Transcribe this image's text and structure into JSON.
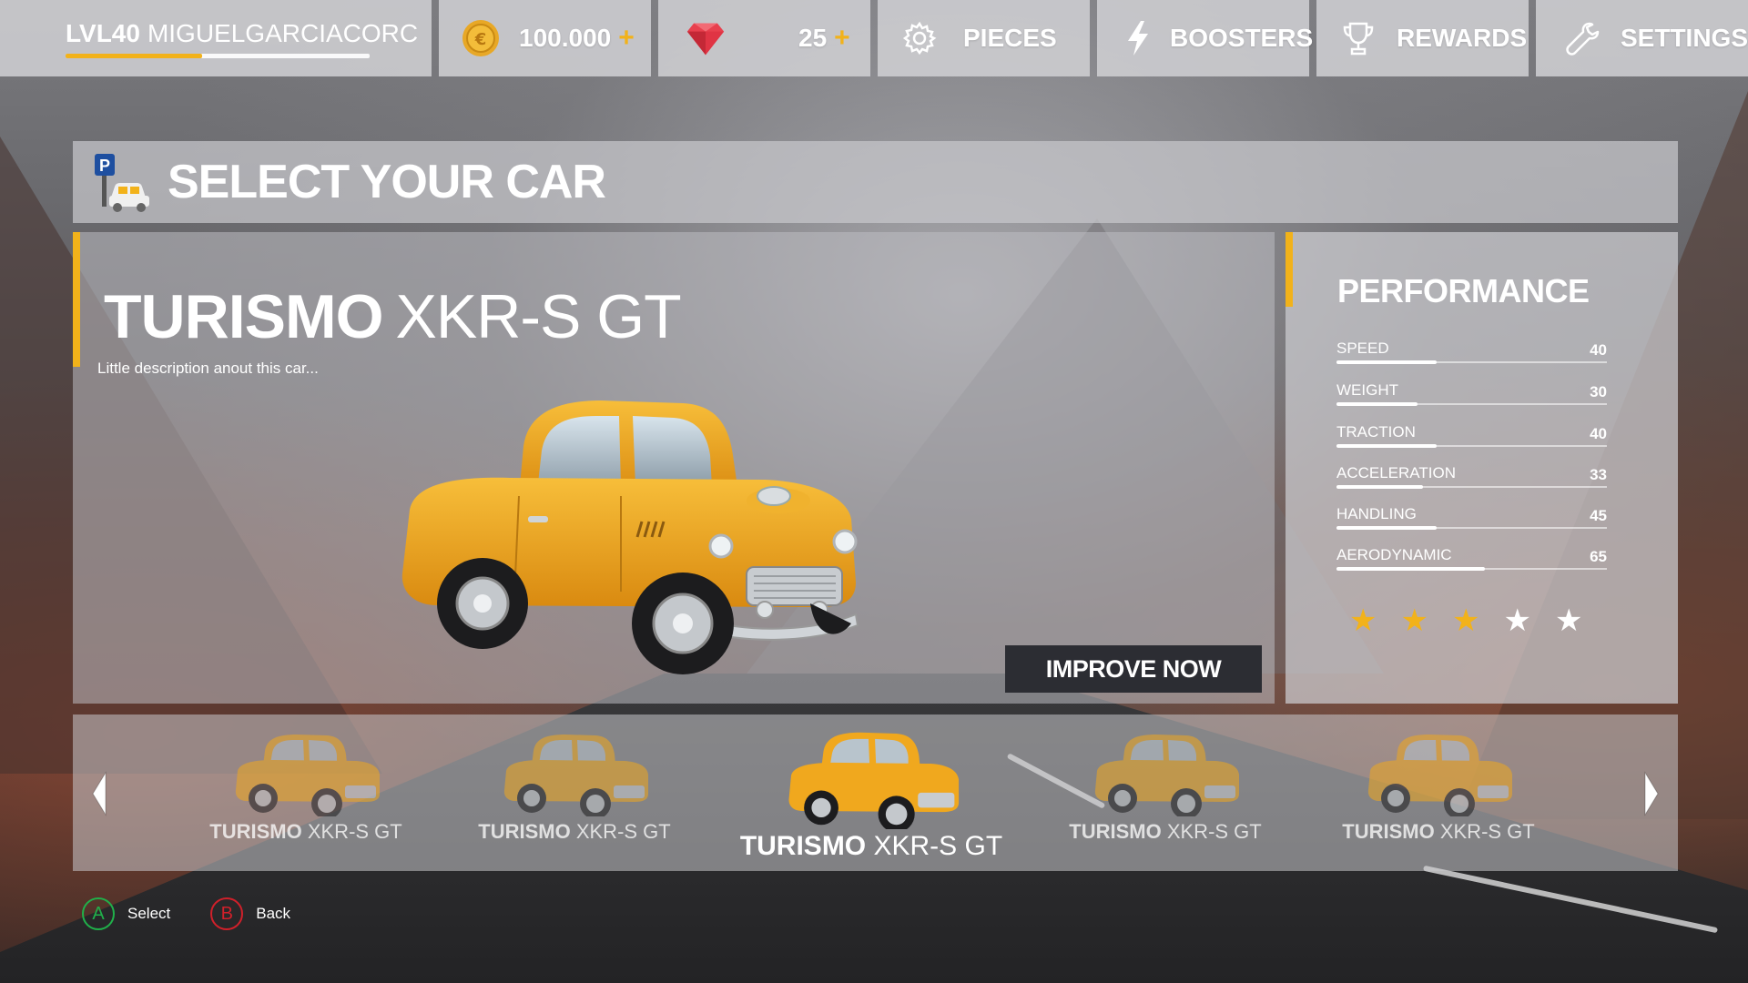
{
  "topbar": {
    "player": {
      "level": "LVL40",
      "name": "MIGUELGARCIACORC",
      "xp_progress": 0.45
    },
    "coins": {
      "value": "100.000",
      "icon": "euro-coin-icon",
      "plus": "+"
    },
    "gems": {
      "value": "25",
      "icon": "ruby-gem-icon",
      "plus": "+"
    },
    "nav": [
      {
        "label": "PIECES",
        "icon": "gear-icon"
      },
      {
        "label": "BOOSTERS",
        "icon": "lightning-icon"
      },
      {
        "label": "REWARDS",
        "icon": "trophy-icon"
      },
      {
        "label": "SETTINGS",
        "icon": "wrench-icon"
      }
    ]
  },
  "header": {
    "title": "SELECT YOUR CAR",
    "icon": "parking-car-icon",
    "icon_letter": "P"
  },
  "car": {
    "brand": "TURISMO",
    "model": "XKR-S GT",
    "description": "Little description anout this car...",
    "improve_label": "IMPROVE NOW"
  },
  "performance": {
    "title": "PERFORMANCE",
    "stats": [
      {
        "label": "SPEED",
        "value": "40",
        "fill": 0.37
      },
      {
        "label": "WEIGHT",
        "value": "30",
        "fill": 0.3
      },
      {
        "label": "TRACTION",
        "value": "40",
        "fill": 0.37
      },
      {
        "label": "ACCELERATION",
        "value": "33",
        "fill": 0.32
      },
      {
        "label": "HANDLING",
        "value": "45",
        "fill": 0.37
      },
      {
        "label": "AERODYNAMIC",
        "value": "65",
        "fill": 0.55
      }
    ],
    "stars_filled": 3,
    "stars_total": 5,
    "star_glyph": "★"
  },
  "carousel": {
    "items": [
      {
        "brand": "TURISMO",
        "model": "XKR-S GT",
        "active": false
      },
      {
        "brand": "TURISMO",
        "model": "XKR-S GT",
        "active": false
      },
      {
        "brand": "TURISMO",
        "model": "XKR-S GT",
        "active": true
      },
      {
        "brand": "TURISMO",
        "model": "XKR-S GT",
        "active": false
      },
      {
        "brand": "TURISMO",
        "model": "XKR-S GT",
        "active": false
      }
    ]
  },
  "hints": [
    {
      "key": "A",
      "label": "Select",
      "color": "#20b04a"
    },
    {
      "key": "B",
      "label": "Back",
      "color": "#d0202a"
    }
  ],
  "colors": {
    "accent": "#f2b21a",
    "car_body": "#f0a81e",
    "button_dark": "#2c2d33"
  }
}
